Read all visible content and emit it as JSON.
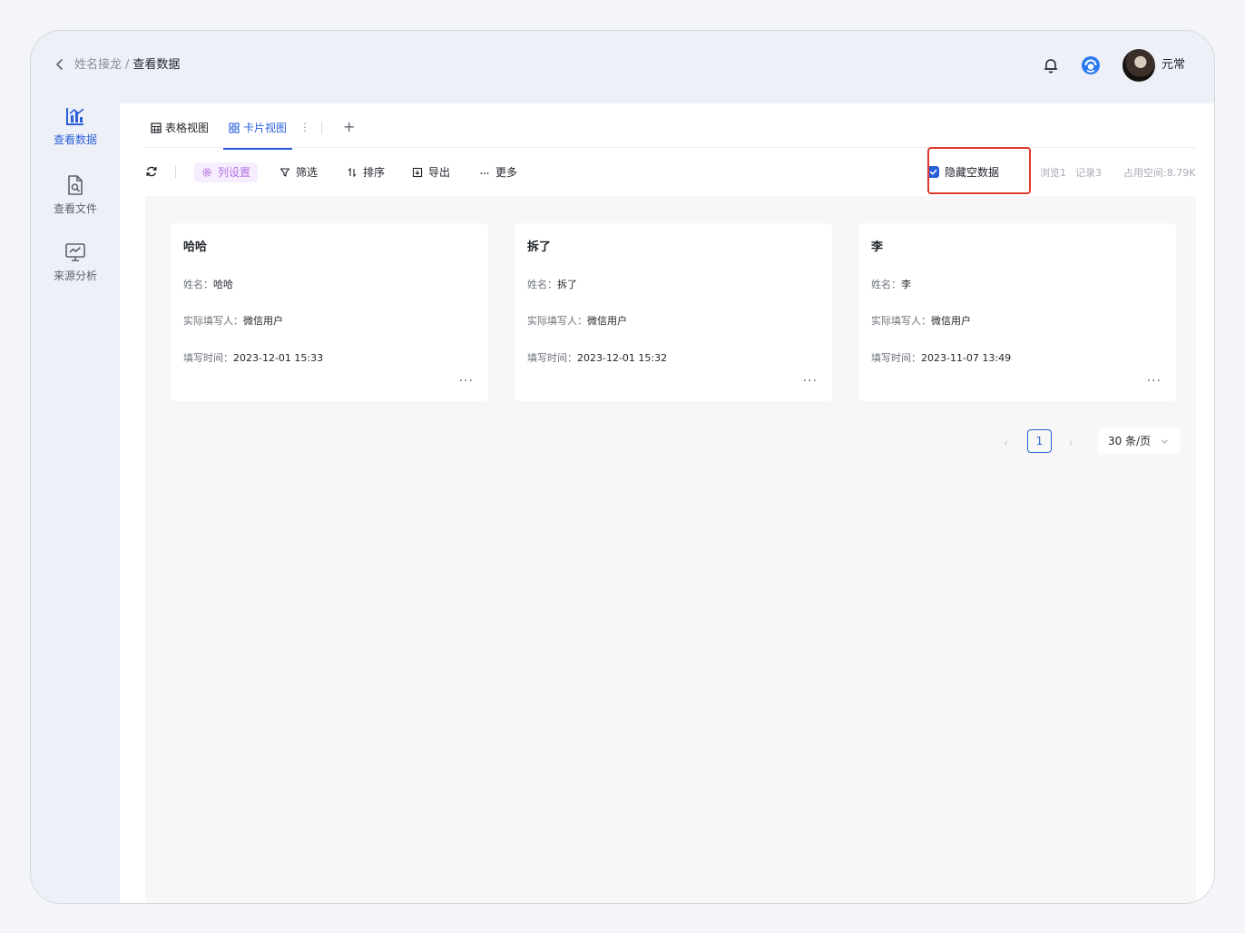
{
  "header": {
    "breadcrumb_parent": "姓名接龙",
    "breadcrumb_separator": "/",
    "breadcrumb_current": "查看数据",
    "username": "元常",
    "icons": [
      "back-icon",
      "bell-icon",
      "service-icon"
    ]
  },
  "sidebar": {
    "items": [
      {
        "label": "查看数据",
        "icon": "data-chart-icon",
        "active": true
      },
      {
        "label": "查看文件",
        "icon": "file-search-icon",
        "active": false
      },
      {
        "label": "来源分析",
        "icon": "monitor-analytics-icon",
        "active": false
      }
    ]
  },
  "tabs": [
    {
      "label": "表格视图",
      "icon": "table-icon",
      "active": false
    },
    {
      "label": "卡片视图",
      "icon": "grid-icon",
      "active": true
    }
  ],
  "tab_more": "⋮",
  "tab_add": "+",
  "toolbar": {
    "column_settings": "列设置",
    "filter": "筛选",
    "sort": "排序",
    "export": "导出",
    "more": "更多",
    "hide_empty": "隐藏空数据",
    "hide_empty_checked": true,
    "views": "浏览1",
    "records": "记录3",
    "storage": "占用空间:8.79K"
  },
  "cards": [
    {
      "title": "哈哈",
      "name_label": "姓名：",
      "name": "哈哈",
      "filler_label": "实际填写人：",
      "filler": "微信用户",
      "time_label": "填写时间：",
      "time": "2023-12-01 15:33"
    },
    {
      "title": "拆了",
      "name_label": "姓名：",
      "name": "拆了",
      "filler_label": "实际填写人：",
      "filler": "微信用户",
      "time_label": "填写时间：",
      "time": "2023-12-01 15:32"
    },
    {
      "title": "李",
      "name_label": "姓名：",
      "name": "李",
      "filler_label": "实际填写人：",
      "filler": "微信用户",
      "time_label": "填写时间：",
      "time": "2023-11-07 13:49"
    }
  ],
  "card_more": "···",
  "pagination": {
    "prev": "‹",
    "current_page": "1",
    "next": "›",
    "page_size": "30 条/页"
  },
  "colors": {
    "accent": "#2b5fd9",
    "highlight_border": "#e0382b",
    "column_settings_bg": "#f6eefe",
    "column_settings_text": "#b46fe0"
  }
}
